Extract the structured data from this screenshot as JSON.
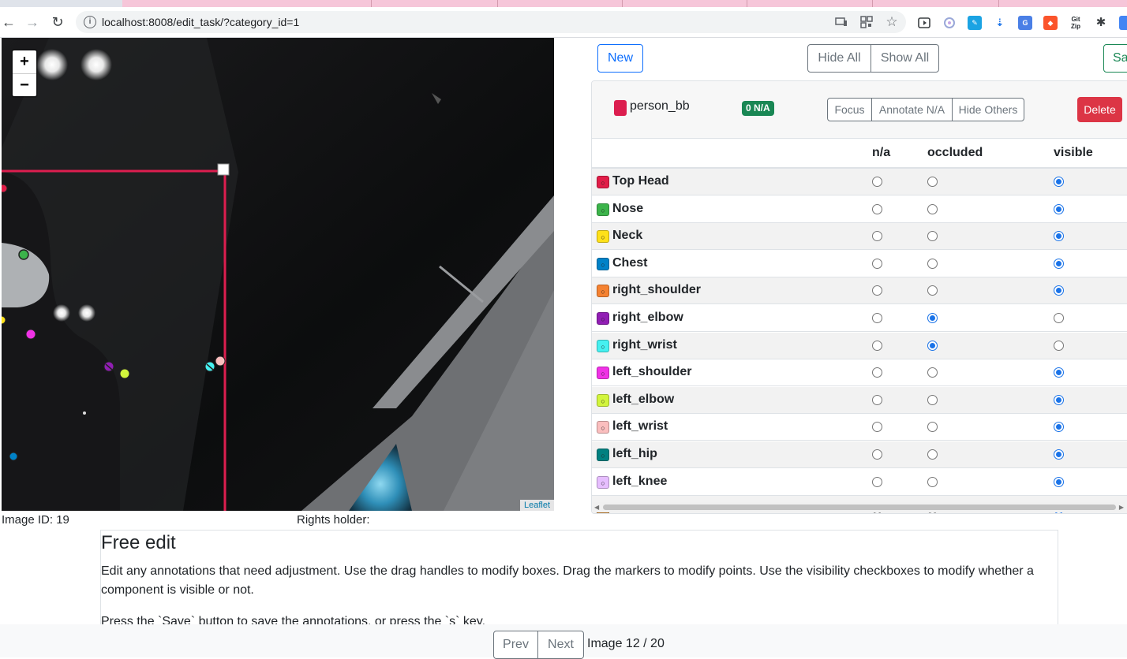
{
  "browser": {
    "url": "localhost:8008/edit_task/?category_id=1",
    "back_glyph": "←",
    "forward_glyph": "→",
    "reload_glyph": "↻",
    "info_glyph": "i",
    "ext_gitzip_label": "Git Zip"
  },
  "map": {
    "zoom_in": "+",
    "zoom_out": "−",
    "attribution": "Leaflet",
    "image_id_text": "Image ID: 19",
    "rights_holder_text": "Rights holder:",
    "box_color": "#dc1e4f"
  },
  "toolbar": {
    "new_label": "New",
    "hide_all_label": "Hide All",
    "show_all_label": "Show All",
    "save_label": "Save"
  },
  "annotation": {
    "category": "person_bb",
    "category_color": "#dc1e4f",
    "na_badge": "0 N/A",
    "focus_label": "Focus",
    "annotate_na_label": "Annotate N/A",
    "hide_others_label": "Hide Others",
    "delete_label": "Delete",
    "columns": [
      "n/a",
      "occluded",
      "visible"
    ],
    "keypoint_glyph": "○",
    "keypoints": [
      {
        "name": "Top Head",
        "color": "#e11d48",
        "state": "visible"
      },
      {
        "name": "Nose",
        "color": "#3cb44b",
        "state": "visible"
      },
      {
        "name": "Neck",
        "color": "#ffe119",
        "state": "visible"
      },
      {
        "name": "Chest",
        "color": "#0082c8",
        "state": "visible"
      },
      {
        "name": "right_shoulder",
        "color": "#f58231",
        "state": "visible"
      },
      {
        "name": "right_elbow",
        "color": "#911eb4",
        "state": "occluded"
      },
      {
        "name": "right_wrist",
        "color": "#46f0f0",
        "state": "occluded"
      },
      {
        "name": "left_shoulder",
        "color": "#f032e6",
        "state": "visible"
      },
      {
        "name": "left_elbow",
        "color": "#d2f53c",
        "state": "visible"
      },
      {
        "name": "left_wrist",
        "color": "#fabebe",
        "state": "visible"
      },
      {
        "name": "left_hip",
        "color": "#008080",
        "state": "visible"
      },
      {
        "name": "left_knee",
        "color": "#e6beff",
        "state": "visible"
      },
      {
        "name": "",
        "color": "#aa6e28",
        "state": "visible"
      }
    ]
  },
  "instructions": {
    "title": "Free edit",
    "body": "Edit any annotations that need adjustment. Use the drag handles to modify boxes. Drag the markers to modify points. Use the visibility checkboxes to modify whether a component is visible or not.",
    "save_hint": "Press the `Save` button to save the annotations, or press the `s` key."
  },
  "pagination": {
    "prev_label": "Prev",
    "next_label": "Next",
    "counter_text": "Image 12 / 20"
  }
}
